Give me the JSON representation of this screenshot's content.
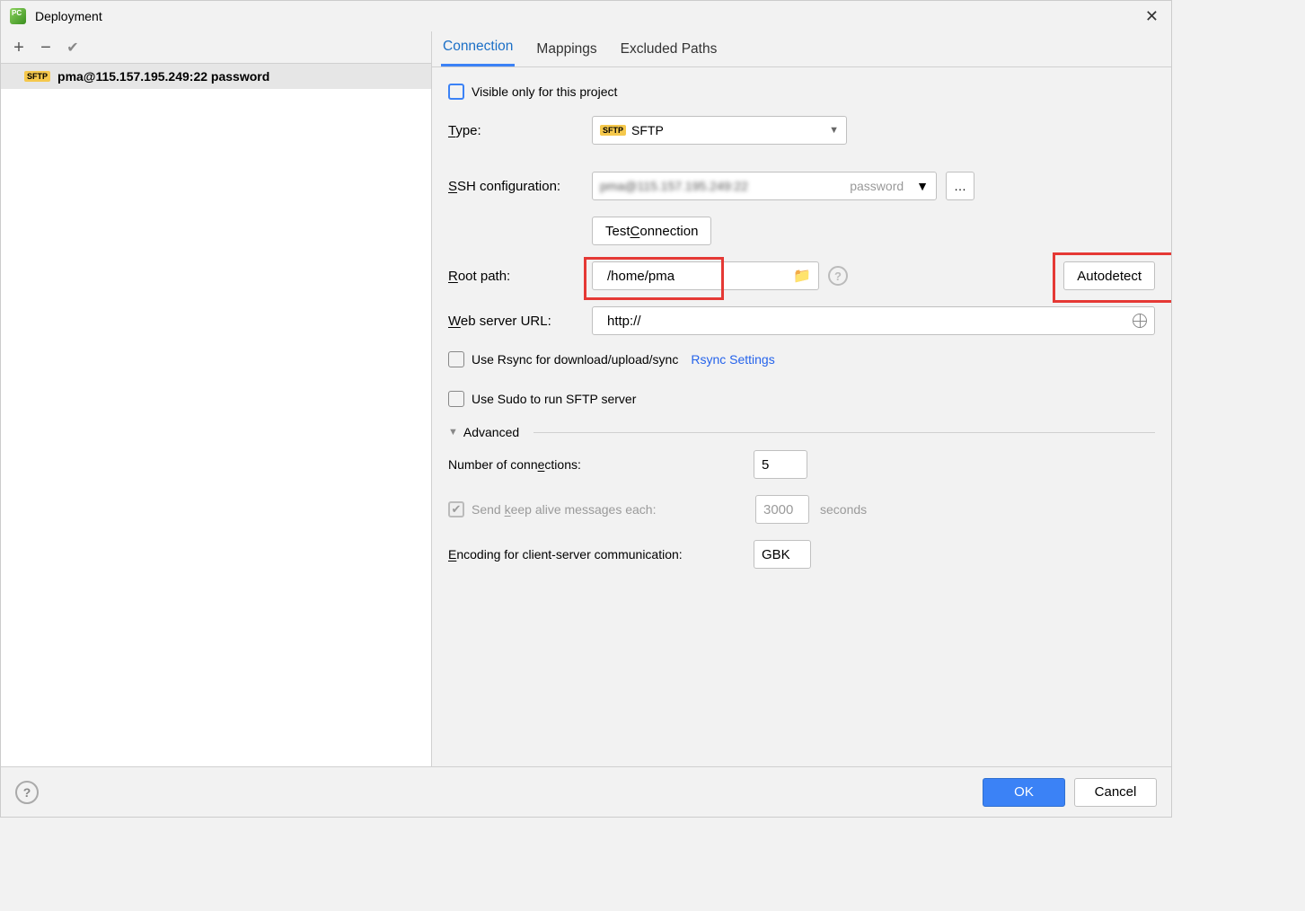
{
  "window": {
    "title": "Deployment"
  },
  "toolbar": {
    "add_label": "+",
    "remove_label": "-",
    "apply_label": "✓"
  },
  "servers": [
    {
      "badge": "SFTP",
      "name": "pma@115.157.195.249:22 password"
    }
  ],
  "tabs": {
    "connection": "Connection",
    "mappings": "Mappings",
    "excluded": "Excluded Paths",
    "active": "connection"
  },
  "form": {
    "visible_only": "Visible only for this project",
    "type_label": "Type:",
    "type_value": "SFTP",
    "ssh_label": "SSH configuration:",
    "ssh_hint": "password",
    "test_connection": "Test Connection",
    "root_label": "Root path:",
    "root_value": "/home/pma",
    "autodetect": "Autodetect",
    "web_label": "Web server URL:",
    "web_value": "http://",
    "rsync_label": "Use Rsync for download/upload/sync",
    "rsync_link": "Rsync Settings",
    "sudo_label": "Use Sudo to run SFTP server",
    "advanced": "Advanced",
    "connections_label": "Number of connections:",
    "connections_value": "5",
    "keepalive_label": "Send keep alive messages each:",
    "keepalive_value": "3000",
    "keepalive_unit": "seconds",
    "encoding_label": "Encoding for client-server communication:",
    "encoding_value": "GBK"
  },
  "footer": {
    "ok": "OK",
    "cancel": "Cancel"
  }
}
